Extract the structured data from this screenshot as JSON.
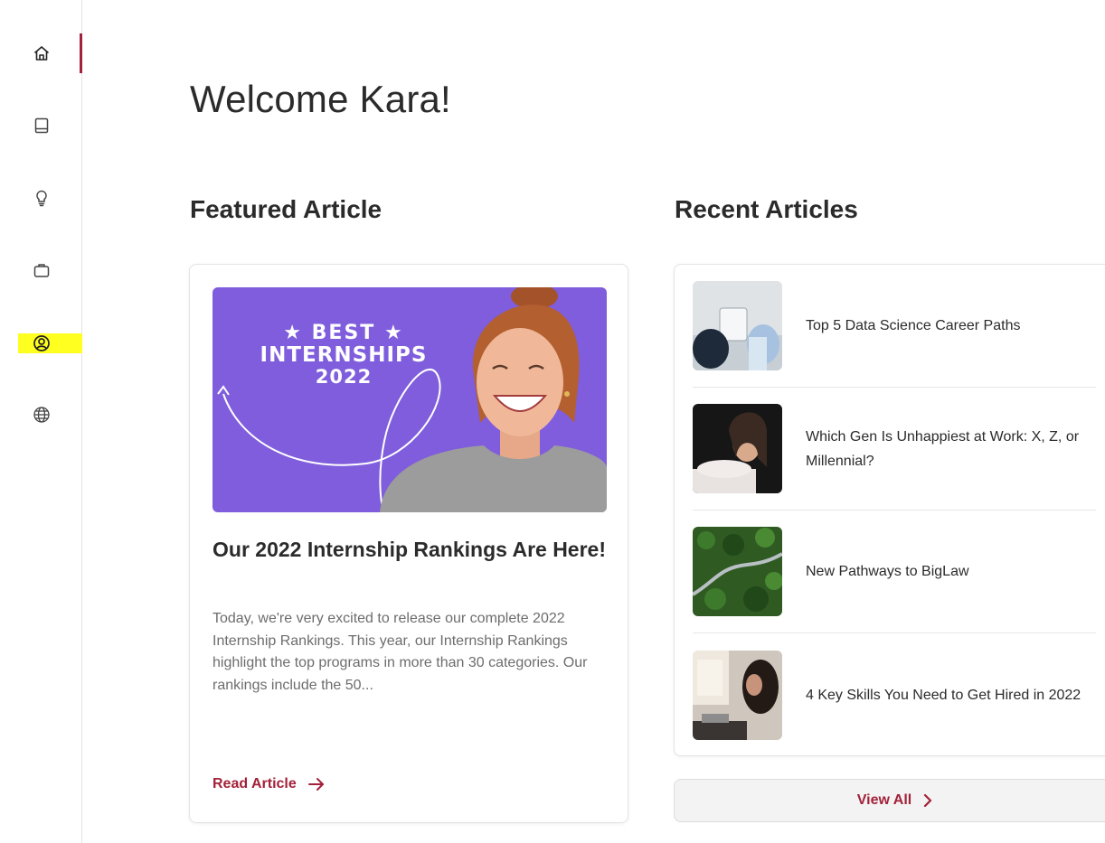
{
  "colors": {
    "accent": "#a3213a",
    "hero_bg": "#7f5ddc",
    "highlight": "#ffff20"
  },
  "sidebar": {
    "items": [
      {
        "name": "home",
        "icon": "home-icon",
        "active": true
      },
      {
        "name": "book",
        "icon": "book-icon",
        "active": false
      },
      {
        "name": "lightbulb",
        "icon": "lightbulb-icon",
        "active": false
      },
      {
        "name": "briefcase",
        "icon": "briefcase-icon",
        "active": false
      },
      {
        "name": "profile",
        "icon": "user-circle-icon",
        "active": false
      },
      {
        "name": "globe",
        "icon": "globe-icon",
        "active": false
      }
    ]
  },
  "page": {
    "title": "Welcome Kara!"
  },
  "featured": {
    "section_title": "Featured Article",
    "image_text": {
      "line1": "★ BEST ★",
      "line2": "INTERNSHIPS",
      "line3": "2022"
    },
    "title": "Our 2022 Internship Rankings Are Here!",
    "excerpt": "Today, we're very excited to release our complete 2022 Internship Rankings. This year, our Internship Rankings highlight the top programs in more than 30 categories. Our rankings include the 50...",
    "read_label": "Read Article"
  },
  "recent": {
    "section_title": "Recent Articles",
    "items": [
      {
        "title": "Top 5 Data Science Career Paths"
      },
      {
        "title": "Which Gen Is Unhappiest at Work: X, Z, or Millennial?"
      },
      {
        "title": "New Pathways to BigLaw"
      },
      {
        "title": "4 Key Skills You Need to Get Hired in 2022"
      }
    ],
    "view_all_label": "View All"
  }
}
